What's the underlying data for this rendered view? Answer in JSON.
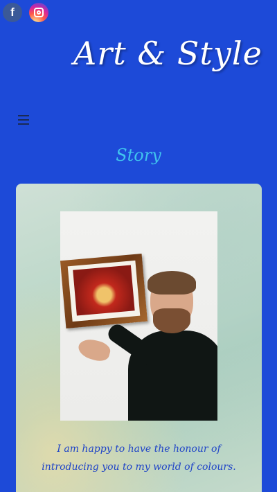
{
  "social": {
    "facebook_glyph": "f",
    "items": [
      {
        "name": "facebook",
        "color": "#3b5998"
      },
      {
        "name": "instagram",
        "color": "#d6249f"
      }
    ]
  },
  "header": {
    "logo_text": "Art & Style"
  },
  "nav": {
    "menu_icon": "hamburger-icon"
  },
  "main": {
    "title": "Story",
    "photo": {
      "description_icon": "artist-with-painting-photo"
    },
    "caption_line1": "I am happy to have the honour of",
    "caption_line2": "introducing you to my world of colours."
  },
  "colors": {
    "background": "#1d4ad8",
    "title": "#40c4ee",
    "caption": "#1f44c7"
  }
}
